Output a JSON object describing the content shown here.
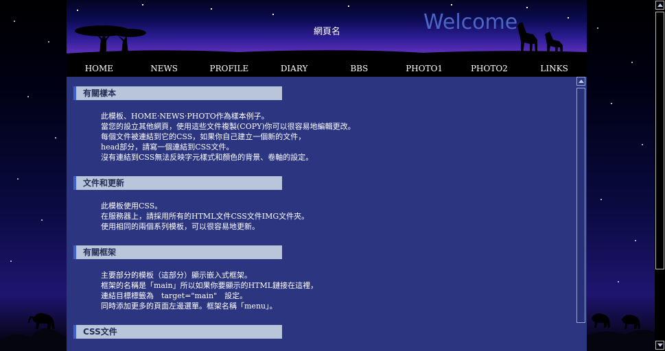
{
  "header": {
    "site_name": "網頁名",
    "welcome": "Welcome"
  },
  "nav": {
    "items": [
      "HOME",
      "NEWS",
      "PROFILE",
      "DIARY",
      "BBS",
      "PHOTO1",
      "PHOTO2",
      "LINKS"
    ]
  },
  "sections": [
    {
      "title": "有關樣本",
      "lines": [
        "此模板、HOME‧NEWS‧PHOTO作為樣本例子。",
        "當您的設立其他網頁，使用這些文件複製(COPY)你可以很容易地編輯更改。",
        "每個文件被連結到它的CSS，如果你自己建立一個新的文件，",
        "head部分，請寫一個連結到CSS文件。",
        "沒有連結到CSS無法反映字元樣式和顏色的背景、卷軸的設定。"
      ]
    },
    {
      "title": "文件和更新",
      "lines": [
        "此模板使用CSS。",
        "在服務器上，請採用所有的HTML文件CSS文件IMG文件夾。",
        "使用相同的兩個系列模板，可以很容易地更新。"
      ]
    },
    {
      "title": "有關框架",
      "lines": [
        "主要部分的模板（這部分）顯示嵌入式框架。",
        "框架的名稱是「main」所以如果你要顯示的HTML鏈接在這裡，",
        "連結目標標籤為　target=\"main\"　設定。",
        "同時添加更多的頁面左邊選單。框架名稱「menu」。"
      ]
    },
    {
      "title": "CSS文件",
      "lines": []
    }
  ],
  "colors": {
    "content_bg": "#2b3580",
    "section_header_bg": "#b8c5da",
    "section_header_accent": "#3f63c9",
    "welcome_text": "#4d66c6"
  }
}
